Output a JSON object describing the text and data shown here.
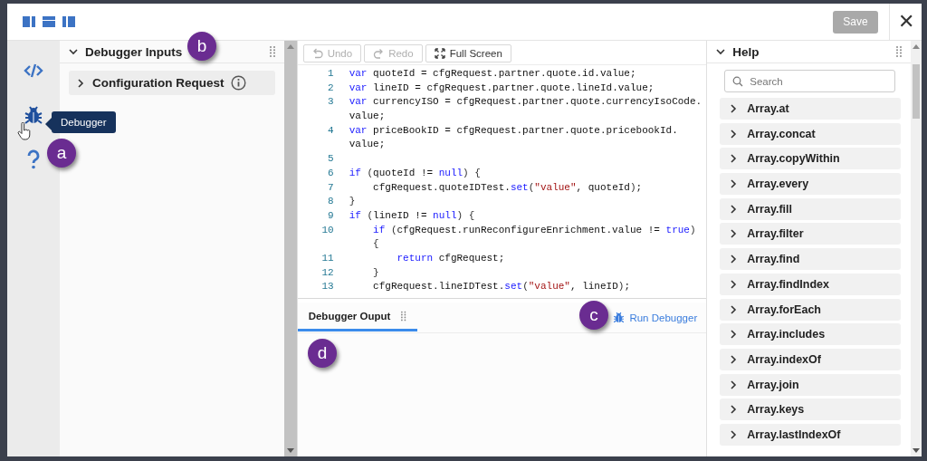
{
  "toolbar": {
    "layout_buttons": [
      {
        "kind": "left"
      },
      {
        "kind": "top"
      },
      {
        "kind": "right"
      }
    ],
    "save": {
      "label": "Save",
      "disabled": true
    },
    "close": {
      "label": "✕"
    }
  },
  "rail": {
    "items": [
      {
        "kind": "code"
      },
      {
        "kind": "bug",
        "hovered": true
      },
      {
        "kind": "help"
      }
    ],
    "tooltip": "Debugger"
  },
  "inputs_panel": {
    "title": "Debugger Inputs",
    "expanded": true,
    "items": [
      {
        "label": "Configuration Request",
        "expanded": false
      }
    ]
  },
  "editor": {
    "buttons": [
      {
        "label": "Undo",
        "kind": "undo",
        "disabled": true
      },
      {
        "label": "Redo",
        "kind": "redo",
        "disabled": true
      },
      {
        "label": "Full Screen",
        "kind": "fullscreen",
        "disabled": false
      }
    ],
    "lines": [
      {
        "number": "1",
        "rows": [
          [
            {
              "kind": "kw",
              "text": "var"
            },
            {
              "kind": "plain",
              "text": " quoteId = cfgRequest.partner.quote.id.value;"
            }
          ]
        ]
      },
      {
        "number": "2",
        "rows": [
          [
            {
              "kind": "kw",
              "text": "var"
            },
            {
              "kind": "plain",
              "text": " lineID = cfgRequest.partner.quote.lineId.value;"
            }
          ]
        ]
      },
      {
        "number": "3",
        "rows": [
          [
            {
              "kind": "kw",
              "text": "var"
            },
            {
              "kind": "plain",
              "text": " currencyISO = cfgRequest.partner.quote.currencyIsoCode."
            }
          ],
          [
            {
              "kind": "plain",
              "text": "value;"
            }
          ]
        ]
      },
      {
        "number": "4",
        "rows": [
          [
            {
              "kind": "kw",
              "text": "var"
            },
            {
              "kind": "plain",
              "text": " priceBookID = cfgRequest.partner.quote.pricebookId."
            }
          ],
          [
            {
              "kind": "plain",
              "text": "value;"
            }
          ]
        ]
      },
      {
        "number": "5",
        "rows": [
          []
        ]
      },
      {
        "number": "6",
        "rows": [
          [
            {
              "kind": "kw",
              "text": "if"
            },
            {
              "kind": "punct",
              "text": " ("
            },
            {
              "kind": "plain",
              "text": "quoteId != "
            },
            {
              "kind": "kw",
              "text": "null"
            },
            {
              "kind": "punct",
              "text": ") {"
            }
          ]
        ]
      },
      {
        "number": "7",
        "rows": [
          [
            {
              "kind": "plain",
              "text": "    cfgRequest.quoteIDTest."
            },
            {
              "kind": "kw",
              "text": "set"
            },
            {
              "kind": "punct",
              "text": "("
            },
            {
              "kind": "str",
              "text": "\"value\""
            },
            {
              "kind": "plain",
              "text": ", quoteId"
            },
            {
              "kind": "punct",
              "text": ")"
            },
            {
              "kind": "plain",
              "text": ";"
            }
          ]
        ]
      },
      {
        "number": "8",
        "rows": [
          [
            {
              "kind": "punct",
              "text": "}"
            }
          ]
        ]
      },
      {
        "number": "9",
        "rows": [
          [
            {
              "kind": "kw",
              "text": "if"
            },
            {
              "kind": "punct",
              "text": " ("
            },
            {
              "kind": "plain",
              "text": "lineID != "
            },
            {
              "kind": "kw",
              "text": "null"
            },
            {
              "kind": "punct",
              "text": ") {"
            }
          ]
        ]
      },
      {
        "number": "10",
        "rows": [
          [
            {
              "kind": "plain",
              "text": "    "
            },
            {
              "kind": "kw",
              "text": "if"
            },
            {
              "kind": "punct",
              "text": " ("
            },
            {
              "kind": "plain",
              "text": "cfgRequest.runReconfigureEnrichment.value != "
            },
            {
              "kind": "kw",
              "text": "true"
            },
            {
              "kind": "punct",
              "text": ")"
            }
          ],
          [
            {
              "kind": "punct",
              "text": "    {"
            }
          ]
        ]
      },
      {
        "number": "11",
        "rows": [
          [
            {
              "kind": "plain",
              "text": "        "
            },
            {
              "kind": "kw",
              "text": "return"
            },
            {
              "kind": "plain",
              "text": " cfgRequest;"
            }
          ]
        ]
      },
      {
        "number": "12",
        "rows": [
          [
            {
              "kind": "punct",
              "text": "    }"
            }
          ]
        ]
      },
      {
        "number": "13",
        "rows": [
          [
            {
              "kind": "plain",
              "text": "    cfgRequest.lineIDTest."
            },
            {
              "kind": "kw",
              "text": "set"
            },
            {
              "kind": "punct",
              "text": "("
            },
            {
              "kind": "str",
              "text": "\"value\""
            },
            {
              "kind": "plain",
              "text": ", lineID"
            },
            {
              "kind": "punct",
              "text": ")"
            },
            {
              "kind": "plain",
              "text": ";"
            }
          ]
        ]
      }
    ]
  },
  "output": {
    "tabs": [
      {
        "label": "Debugger Ouput",
        "selected": true
      }
    ],
    "run_button": "Run Debugger"
  },
  "help": {
    "title": "Help",
    "expanded": true,
    "search": {
      "placeholder": "Search"
    },
    "items": [
      {
        "label": "Array.at"
      },
      {
        "label": "Array.concat"
      },
      {
        "label": "Array.copyWithin"
      },
      {
        "label": "Array.every"
      },
      {
        "label": "Array.fill"
      },
      {
        "label": "Array.filter"
      },
      {
        "label": "Array.find"
      },
      {
        "label": "Array.findIndex"
      },
      {
        "label": "Array.forEach"
      },
      {
        "label": "Array.includes"
      },
      {
        "label": "Array.indexOf"
      },
      {
        "label": "Array.join"
      },
      {
        "label": "Array.keys"
      },
      {
        "label": "Array.lastIndexOf"
      }
    ]
  },
  "callouts": [
    {
      "label": "a"
    },
    {
      "label": "b"
    },
    {
      "label": "c"
    },
    {
      "label": "d"
    }
  ]
}
